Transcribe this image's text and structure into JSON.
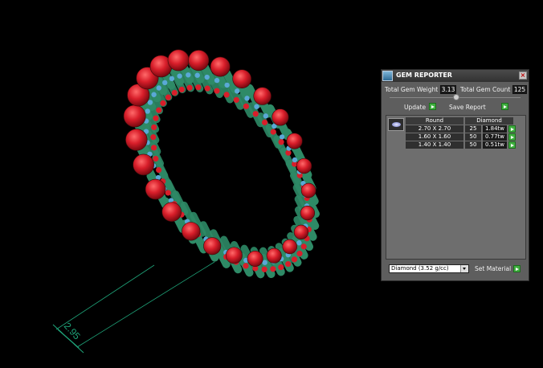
{
  "dimension": {
    "value": "2.95"
  },
  "panel": {
    "title": "GEM REPORTER",
    "total_weight_label": "Total Gem Weight",
    "total_weight_value": "3.13",
    "total_count_label": "Total Gem Count",
    "total_count_value": "125",
    "update_label": "Update",
    "save_report_label": "Save Report",
    "headers": [
      "Round",
      "Diamond"
    ],
    "rows": [
      {
        "size": "2.70 X 2.70",
        "count": "25",
        "weight": "1.84tw"
      },
      {
        "size": "1.60 X 1.60",
        "count": "50",
        "weight": "0.77tw"
      },
      {
        "size": "1.40 X 1.40",
        "count": "50",
        "weight": "0.51tw"
      }
    ],
    "material_value": "Diamond    (3.52 g/cc)",
    "set_material_label": "Set Material",
    "close_glyph": "×"
  },
  "colors": {
    "metal": "#2e8a66",
    "ruby": "#d81e2a",
    "accent_stone": "#5aa8d6",
    "dimension_line": "#1fa57a"
  }
}
